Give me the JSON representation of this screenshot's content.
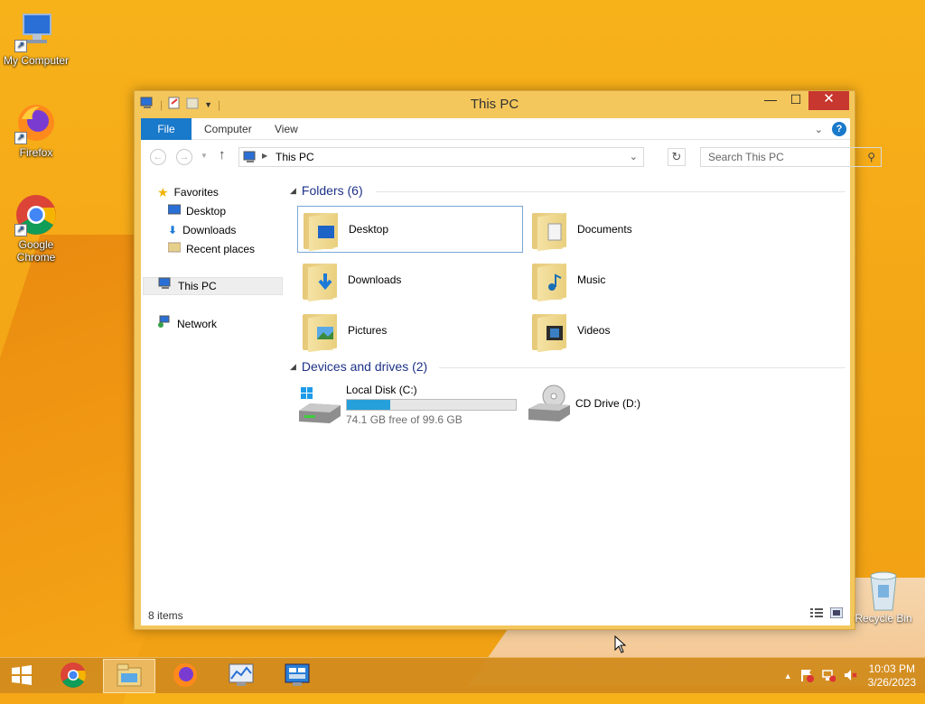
{
  "desktop": {
    "icons": [
      {
        "label": "My Computer"
      },
      {
        "label": "Firefox"
      },
      {
        "label": "Google Chrome"
      }
    ],
    "recycle_bin": {
      "label": "Recycle Bin"
    }
  },
  "window": {
    "title": "This PC",
    "ribbon": {
      "tabs": [
        "File",
        "Computer",
        "View"
      ]
    },
    "address": {
      "path": "This PC"
    },
    "search": {
      "placeholder": "Search This PC"
    },
    "nav": {
      "favorites": "Favorites",
      "favorites_items": [
        "Desktop",
        "Downloads",
        "Recent places"
      ],
      "this_pc": "This PC",
      "network": "Network"
    },
    "folders_group": {
      "title": "Folders (6)"
    },
    "folders": [
      "Desktop",
      "Documents",
      "Downloads",
      "Music",
      "Pictures",
      "Videos"
    ],
    "devices_group": {
      "title": "Devices and drives (2)"
    },
    "drives": [
      {
        "name": "Local Disk (C:)",
        "free_text": "74.1 GB free of 99.6 GB",
        "used_fraction": 0.256
      },
      {
        "name": "CD Drive (D:)"
      }
    ],
    "status": {
      "items": "8 items"
    }
  },
  "taskbar": {
    "clock": {
      "time": "10:03 PM",
      "date": "3/26/2023"
    }
  },
  "colors": {
    "accent": "#1979ca",
    "close": "#c7372f",
    "drive_bar": "#26a0da"
  }
}
